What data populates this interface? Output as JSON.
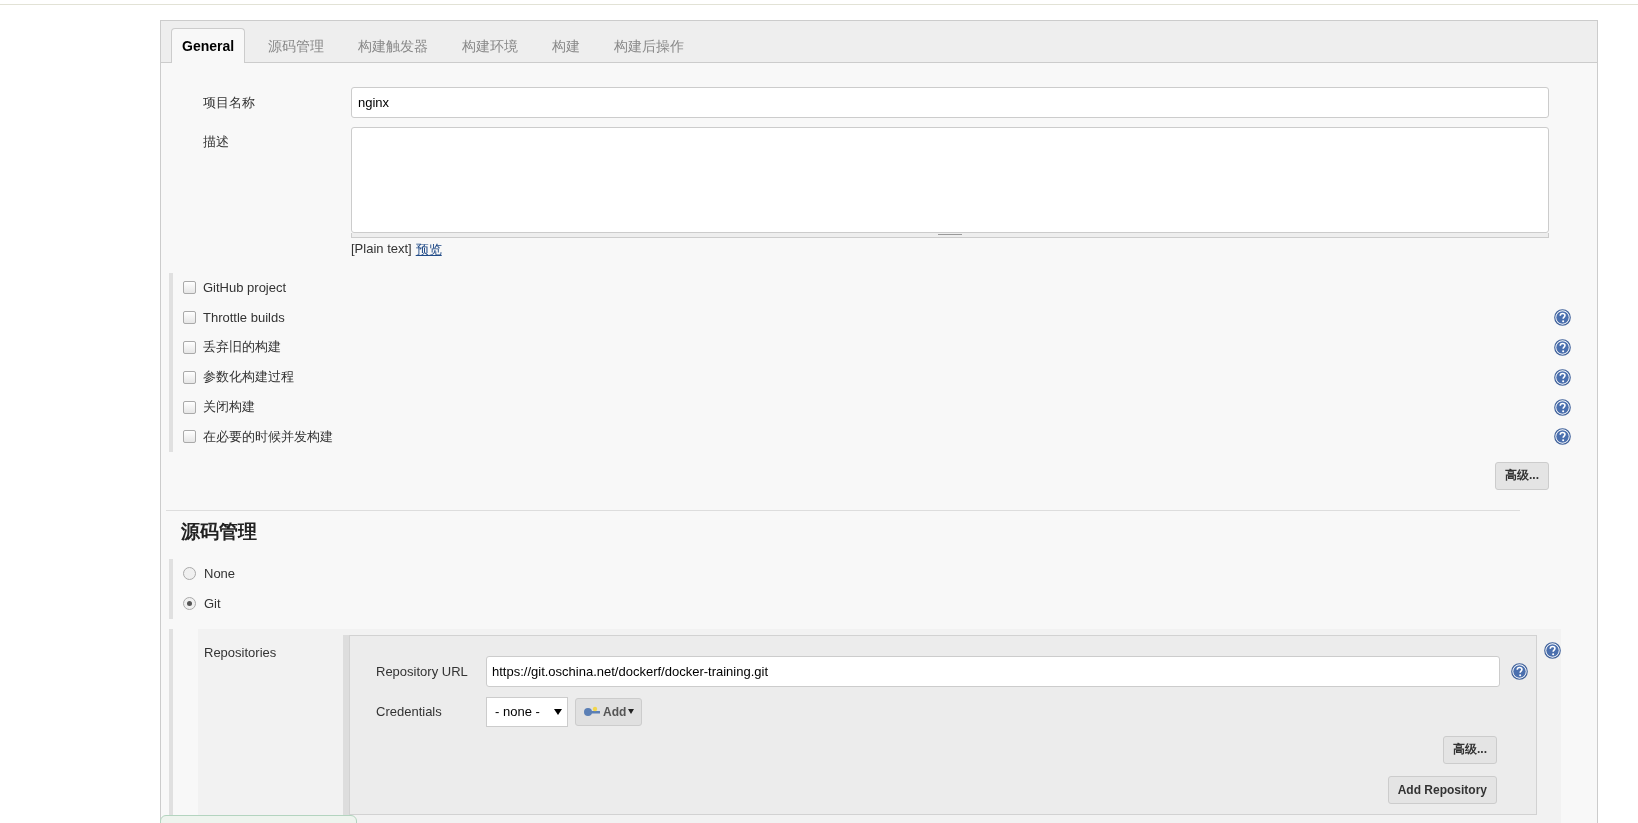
{
  "tabs": [
    {
      "label": "General",
      "selected": true
    },
    {
      "label": "源码管理",
      "selected": false
    },
    {
      "label": "构建触发器",
      "selected": false
    },
    {
      "label": "构建环境",
      "selected": false
    },
    {
      "label": "构建",
      "selected": false
    },
    {
      "label": "构建后操作",
      "selected": false
    }
  ],
  "name_field": {
    "label": "项目名称",
    "value": "nginx"
  },
  "description_field": {
    "label": "描述"
  },
  "format_note": {
    "text": "[Plain text]",
    "preview_link": "预览"
  },
  "options": [
    {
      "label": "GitHub project",
      "checked": false,
      "help": false
    },
    {
      "label": "Throttle builds",
      "checked": false,
      "help": true
    },
    {
      "label": "丢弃旧的构建",
      "checked": false,
      "help": true
    },
    {
      "label": "参数化构建过程",
      "checked": false,
      "help": true
    },
    {
      "label": "关闭构建",
      "checked": false,
      "help": true
    },
    {
      "label": "在必要的时候并发构建",
      "checked": false,
      "help": true
    }
  ],
  "advanced_button": "高级...",
  "scm": {
    "heading": "源码管理",
    "choices": [
      {
        "label": "None",
        "selected": false
      },
      {
        "label": "Git",
        "selected": true
      }
    ],
    "repositories": {
      "label": "Repositories",
      "url_label": "Repository URL",
      "url": "https://git.oschina.net/dockerf/docker-training.git",
      "credentials_label": "Credentials",
      "credentials_value": "- none -",
      "add_button": "Add",
      "advanced_button": "高级...",
      "add_repository_button": "Add Repository"
    }
  }
}
